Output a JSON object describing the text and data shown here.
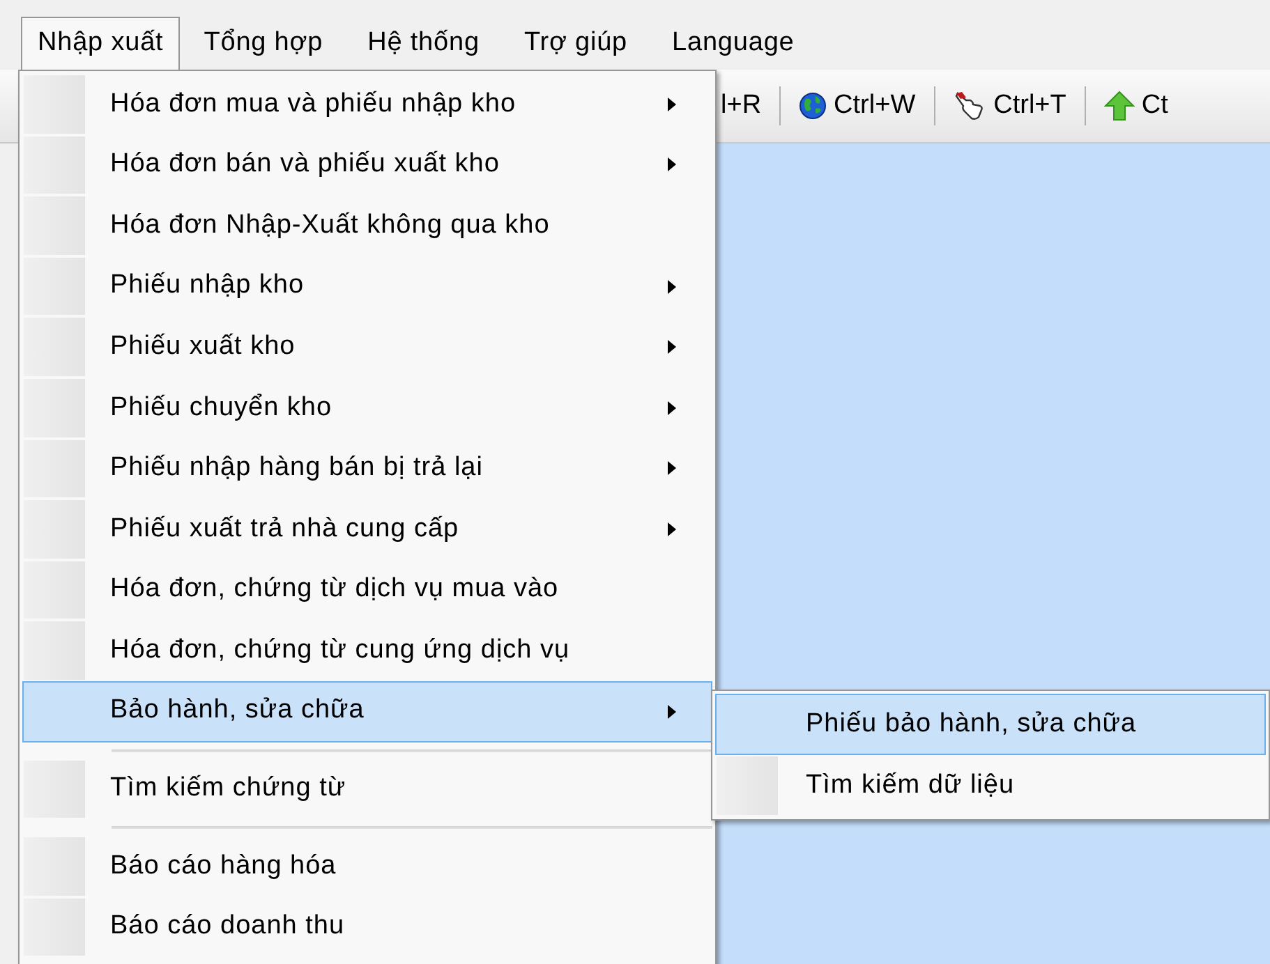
{
  "menu_bar": [
    {
      "label": "Nhập xuất",
      "selected": true
    },
    {
      "label": "Tổng hợp",
      "selected": false
    },
    {
      "label": "Hệ thống",
      "selected": false
    },
    {
      "label": "Trợ giúp",
      "selected": false
    },
    {
      "label": "Language",
      "selected": false
    }
  ],
  "toolbar": [
    {
      "kind": "text",
      "label": "l+R"
    },
    {
      "kind": "globe",
      "label": "Ctrl+W"
    },
    {
      "kind": "hand",
      "label": "Ctrl+T"
    },
    {
      "kind": "up",
      "label": "Ct"
    }
  ],
  "menu": [
    {
      "kind": "item",
      "label": "Hóa đơn mua và phiếu nhập kho",
      "has_submenu": true,
      "selected": false
    },
    {
      "kind": "item",
      "label": "Hóa đơn bán và phiếu xuất kho",
      "has_submenu": true,
      "selected": false
    },
    {
      "kind": "item",
      "label": "Hóa đơn Nhập-Xuất không qua kho",
      "has_submenu": false,
      "selected": false
    },
    {
      "kind": "item",
      "label": "Phiếu nhập kho",
      "has_submenu": true,
      "selected": false
    },
    {
      "kind": "item",
      "label": "Phiếu xuất kho",
      "has_submenu": true,
      "selected": false
    },
    {
      "kind": "item",
      "label": "Phiếu chuyển kho",
      "has_submenu": true,
      "selected": false
    },
    {
      "kind": "item",
      "label": "Phiếu nhập hàng bán bị trả lại",
      "has_submenu": true,
      "selected": false
    },
    {
      "kind": "item",
      "label": "Phiếu xuất trả nhà cung cấp",
      "has_submenu": true,
      "selected": false
    },
    {
      "kind": "item",
      "label": "Hóa đơn, chứng từ dịch vụ mua vào",
      "has_submenu": false,
      "selected": false
    },
    {
      "kind": "item",
      "label": "Hóa đơn, chứng từ cung ứng dịch vụ",
      "has_submenu": false,
      "selected": false
    },
    {
      "kind": "item",
      "label": "Bảo hành, sửa chữa",
      "has_submenu": true,
      "selected": true
    },
    {
      "kind": "separator"
    },
    {
      "kind": "item",
      "label": "Tìm kiếm chứng từ",
      "has_submenu": false,
      "selected": false
    },
    {
      "kind": "separator"
    },
    {
      "kind": "item",
      "label": "Báo cáo hàng hóa",
      "has_submenu": false,
      "selected": false
    },
    {
      "kind": "item",
      "label": "Báo cáo doanh thu",
      "has_submenu": false,
      "selected": false
    }
  ],
  "submenu": [
    {
      "label": "Phiếu bảo hành, sửa chữa",
      "selected": true
    },
    {
      "label": "Tìm kiếm dữ liệu",
      "selected": false
    }
  ]
}
